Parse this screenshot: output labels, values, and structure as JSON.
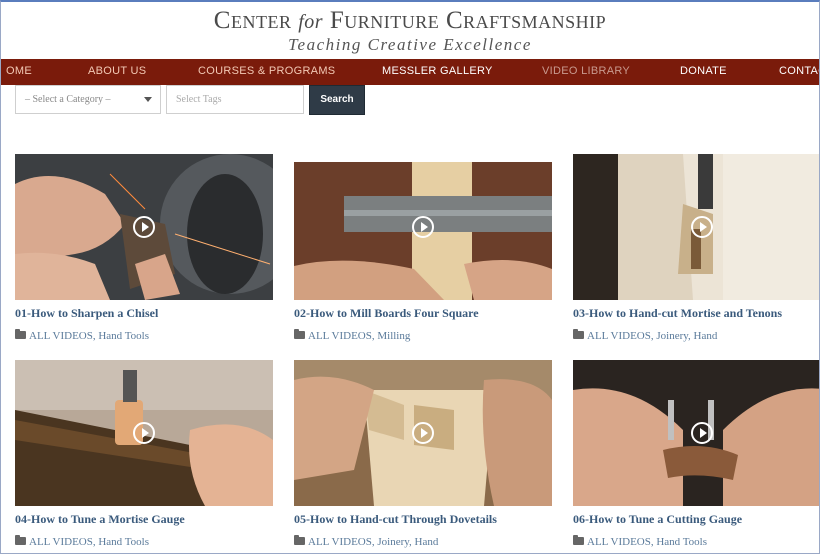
{
  "header": {
    "title_left": "Center",
    "title_for": "for",
    "title_right": "Furniture Craftsmanship",
    "tagline": "Teaching Creative Excellence"
  },
  "nav": {
    "items": [
      {
        "label": "OME",
        "color": "#f3c9b5"
      },
      {
        "label": "ABOUT US",
        "color": "#f3c9b5"
      },
      {
        "label": "COURSES & PROGRAMS",
        "color": "#f3c9b5"
      },
      {
        "label": "MESSLER GALLERY",
        "color": "#ffffff"
      },
      {
        "label": "VIDEO LIBRARY",
        "color": "#c99a8f"
      },
      {
        "label": "DONATE",
        "color": "#ffffff"
      },
      {
        "label": "CONTAC",
        "color": "#ffffff"
      }
    ]
  },
  "filters": {
    "category": "– Select a Category –",
    "tags_placeholder": "Select Tags",
    "search_label": "Search"
  },
  "videos": [
    {
      "title": "01-How to Sharpen a Chisel",
      "meta": "ALL VIDEOS, Hand Tools"
    },
    {
      "title": "02-How to Mill Boards Four Square",
      "meta": "ALL VIDEOS, Milling"
    },
    {
      "title": "03-How to Hand-cut Mortise and Tenons",
      "meta": "ALL VIDEOS, Joinery, Hand"
    },
    {
      "title": "04-How to Tune a Mortise Gauge",
      "meta": "ALL VIDEOS, Hand Tools"
    },
    {
      "title": "05-How to Hand-cut Through Dovetails",
      "meta": "ALL VIDEOS, Joinery, Hand"
    },
    {
      "title": "06-How to Tune a Cutting Gauge",
      "meta": "ALL VIDEOS, Hand Tools"
    }
  ],
  "colors": {
    "nav_bg": "#7a1b0b",
    "link": "#3a5a7c",
    "search_btn": "#2f3b47"
  }
}
